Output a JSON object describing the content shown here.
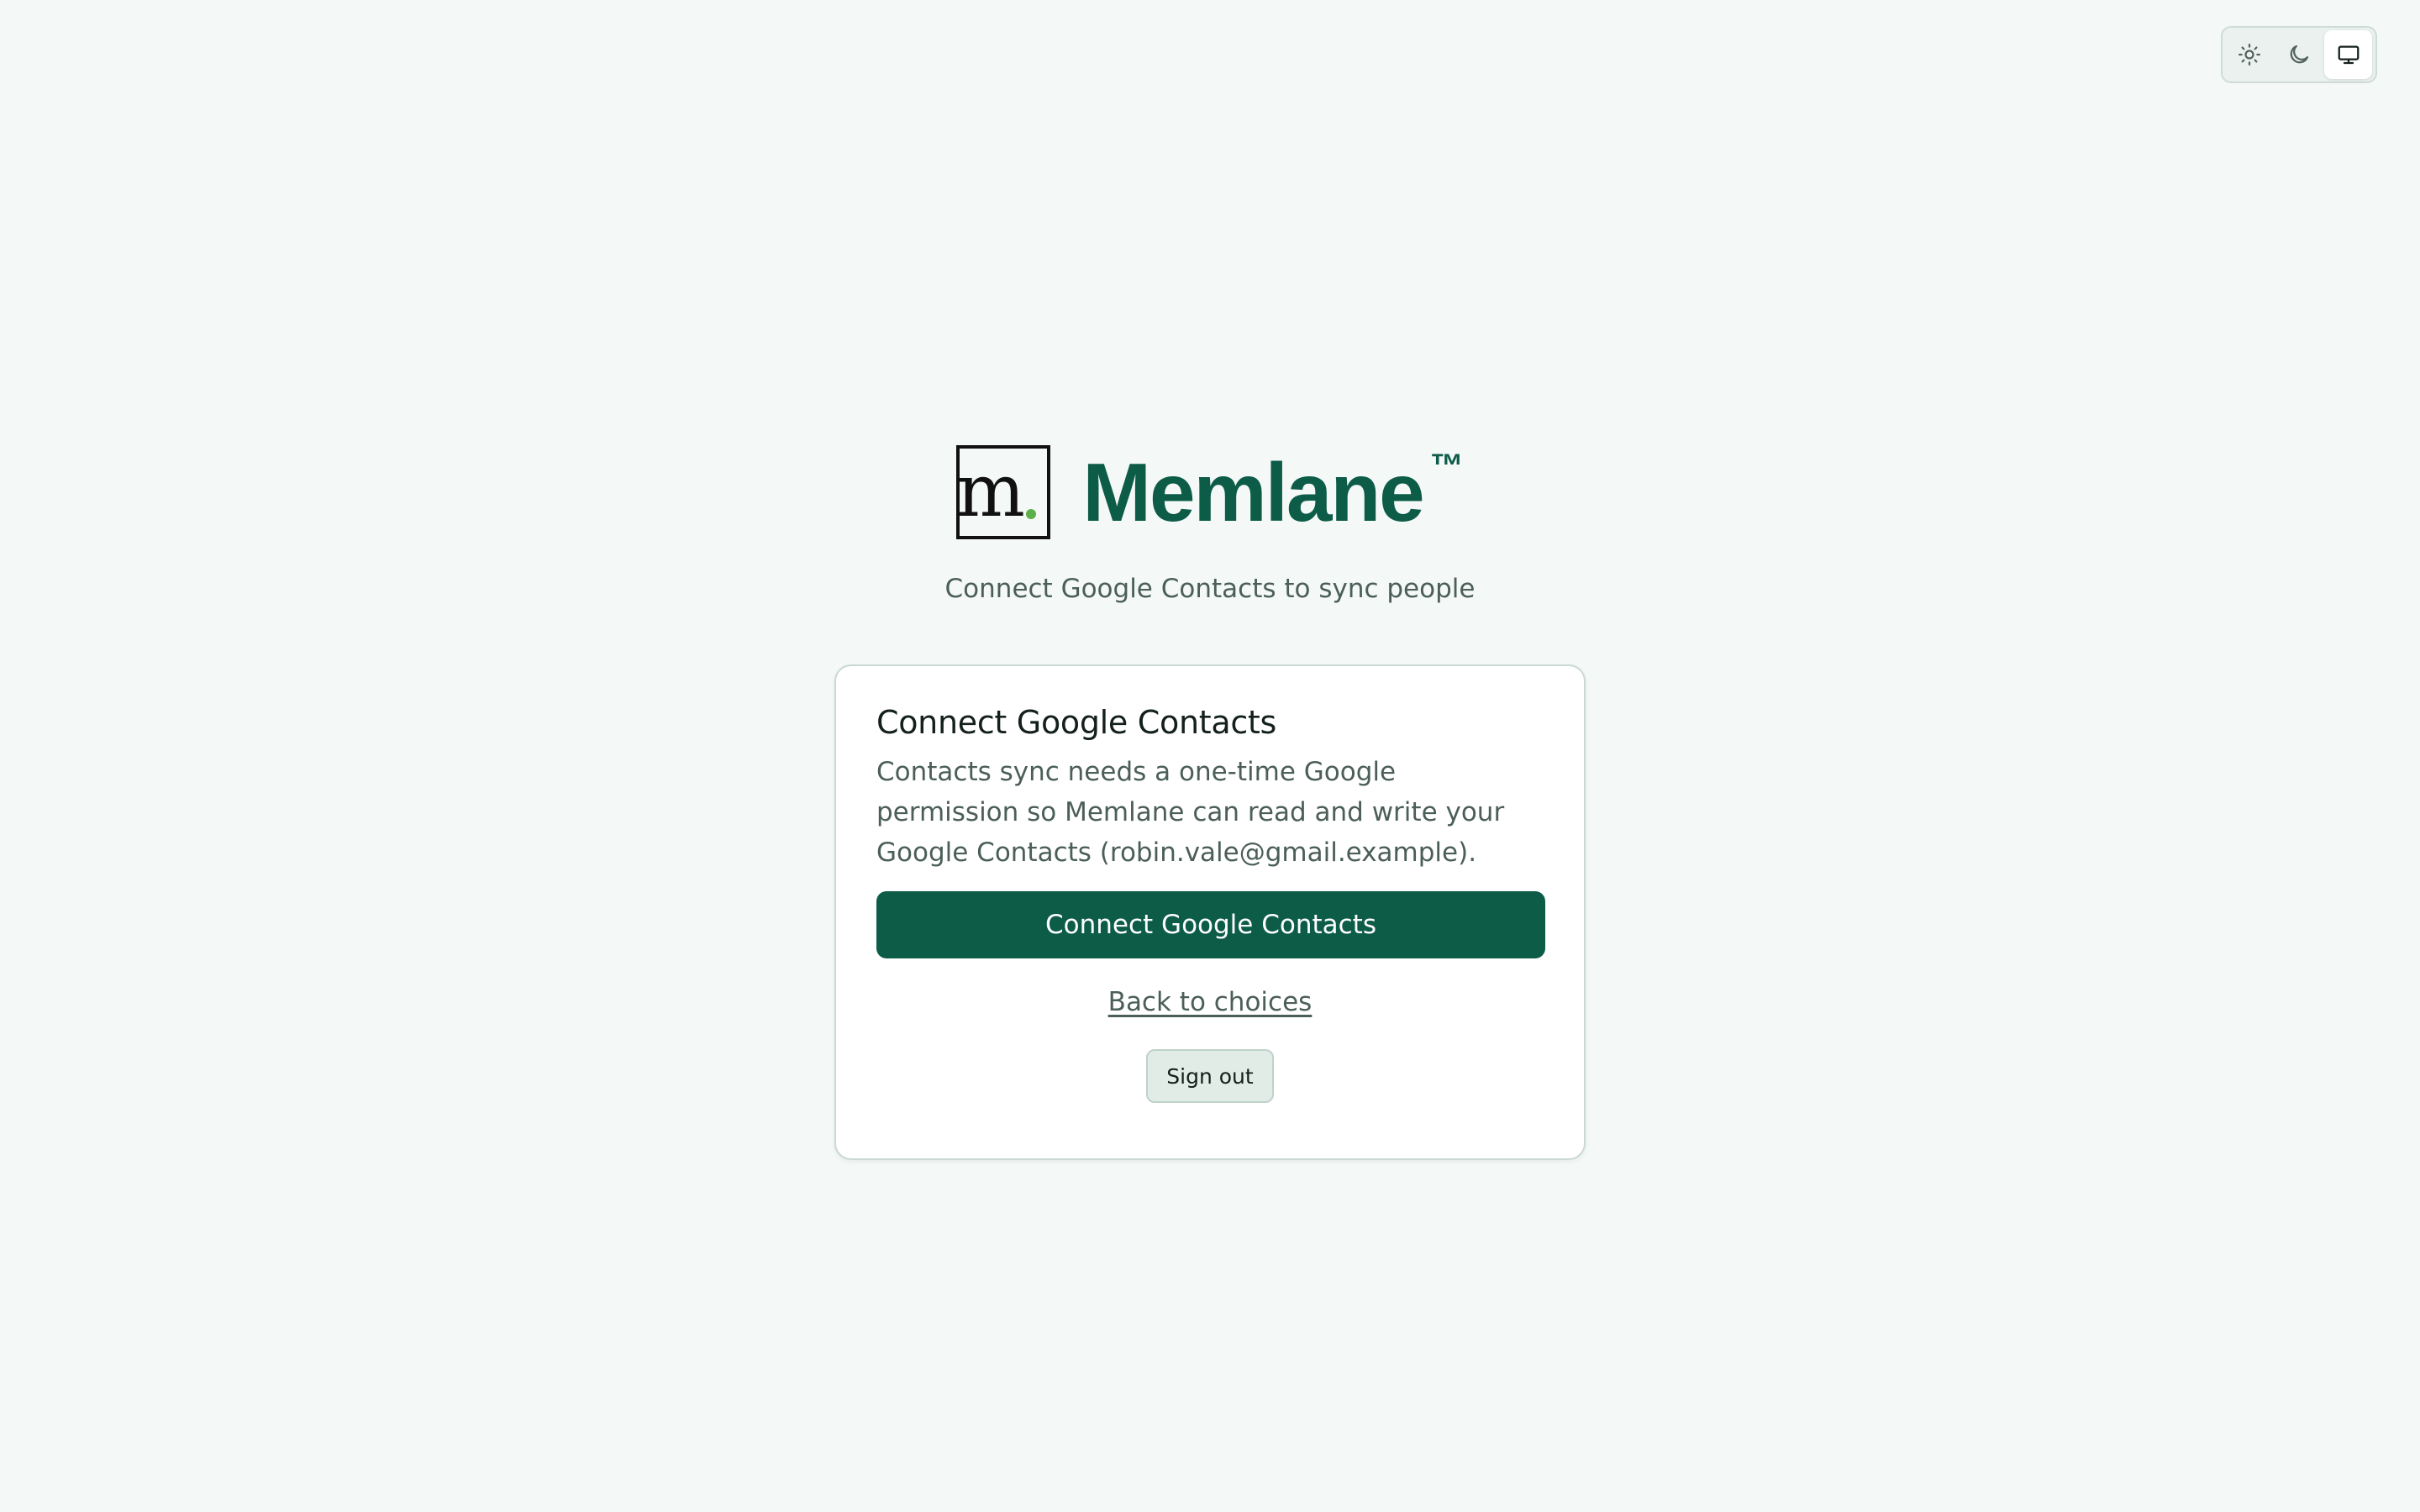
{
  "theme_switcher": {
    "options": [
      {
        "icon": "sun-icon",
        "active": false
      },
      {
        "icon": "moon-icon",
        "active": false
      },
      {
        "icon": "monitor-icon",
        "active": true
      }
    ]
  },
  "brand": {
    "logo_letter": "m",
    "name": "Memlane",
    "trademark": "™",
    "accent_color": "#0d5c48",
    "dot_color": "#5bb04a"
  },
  "subtitle": "Connect Google Contacts to sync people",
  "card": {
    "title": "Connect Google Contacts",
    "description": "Contacts sync needs a one-time Google permission so Memlane can read and write your Google Contacts (robin.vale@gmail.example).",
    "primary_button": "Connect Google Contacts",
    "back_link": "Back to choices",
    "sign_out_button": "Sign out"
  }
}
